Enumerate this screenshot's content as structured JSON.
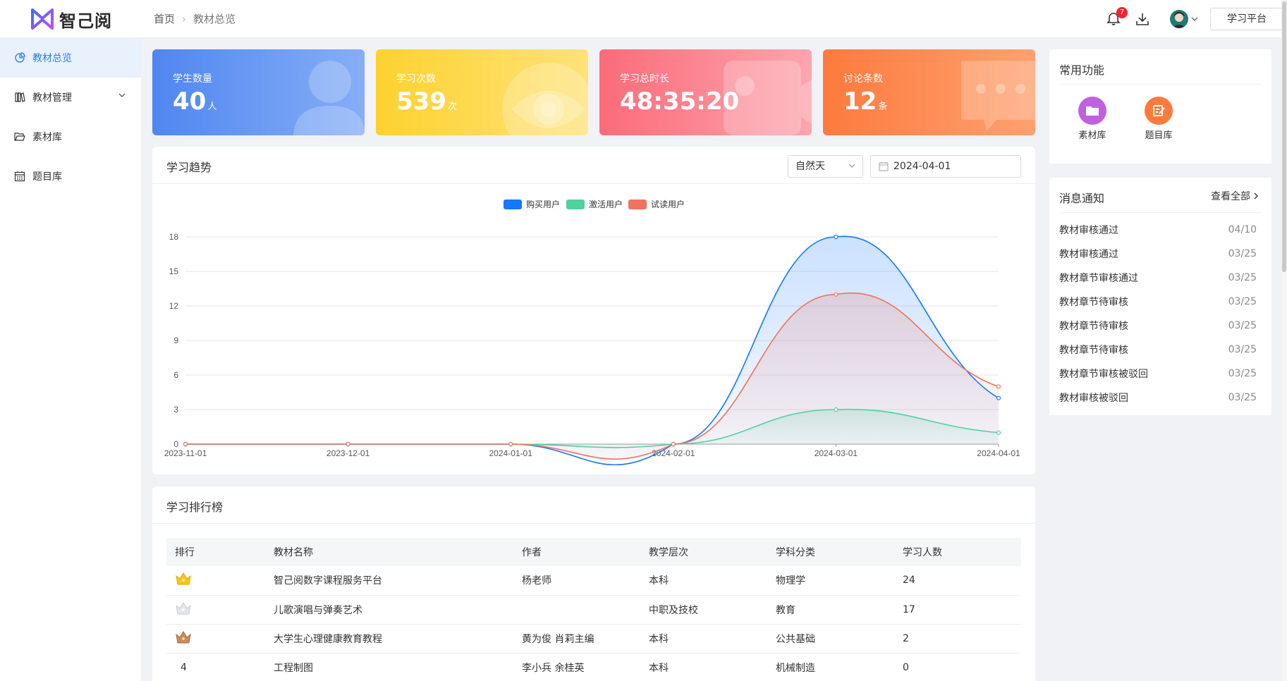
{
  "header": {
    "logo_text": "智己阅",
    "breadcrumb": [
      "首页",
      "教材总览"
    ],
    "notification_count": "7",
    "platform_button": "学习平台"
  },
  "sidebar": {
    "items": [
      {
        "label": "教材总览",
        "icon": "pie-chart-icon",
        "active": true
      },
      {
        "label": "教材管理",
        "icon": "book-icon",
        "has_submenu": true
      },
      {
        "label": "素材库",
        "icon": "folder-icon"
      },
      {
        "label": "题目库",
        "icon": "calendar-grid-icon"
      }
    ]
  },
  "stats": [
    {
      "label": "学生数量",
      "value": "40",
      "unit": "人",
      "color": "#5b8def"
    },
    {
      "label": "学习次数",
      "value": "539",
      "unit": "次",
      "color": "#fdd23c"
    },
    {
      "label": "学习总时长",
      "value": "48:35:20",
      "unit": "",
      "color": "#fb6f7e"
    },
    {
      "label": "讨论条数",
      "value": "12",
      "unit": "条",
      "color": "#fd8a4e"
    }
  ],
  "trend": {
    "title": "学习趋势",
    "select_value": "自然天",
    "date_value": "2024-04-01"
  },
  "chart_data": {
    "type": "line",
    "x": [
      "2023-11-01",
      "2023-12-01",
      "2024-01-01",
      "2024-02-01",
      "2024-03-01",
      "2024-04-01"
    ],
    "ylim": [
      0,
      18
    ],
    "yticks": [
      0,
      3,
      6,
      9,
      12,
      15,
      18
    ],
    "legend_position": "top-center",
    "grid": true,
    "series": [
      {
        "name": "购买用户",
        "values": [
          0,
          0,
          0,
          0,
          18,
          4
        ],
        "color": "#1677ff"
      },
      {
        "name": "激活用户",
        "values": [
          0,
          0,
          0,
          0,
          3,
          1
        ],
        "color": "#4fd1a0"
      },
      {
        "name": "试读用户",
        "values": [
          0,
          0,
          0,
          0,
          13,
          5
        ],
        "color": "#f0735f"
      }
    ]
  },
  "ranking": {
    "title": "学习排行榜",
    "columns": [
      "排行",
      "教材名称",
      "作者",
      "教学层次",
      "学科分类",
      "学习人数"
    ],
    "rows": [
      {
        "rank": "",
        "medal": "gold",
        "name": "智己阅数字课程服务平台",
        "author": "杨老师",
        "level": "本科",
        "subject": "物理学",
        "count": "24"
      },
      {
        "rank": "",
        "medal": "silver",
        "name": "儿歌演唱与弹奏艺术",
        "author": "",
        "level": "中职及技校",
        "subject": "教育",
        "count": "17"
      },
      {
        "rank": "",
        "medal": "bronze",
        "name": "大学生心理健康教育教程",
        "author": "黄为俊 肖莉主编",
        "level": "本科",
        "subject": "公共基础",
        "count": "2"
      },
      {
        "rank": "4",
        "medal": "",
        "name": "工程制图",
        "author": "李小兵 余桂英",
        "level": "本科",
        "subject": "机械制造",
        "count": "0"
      }
    ]
  },
  "quick_functions": {
    "title": "常用功能",
    "items": [
      {
        "label": "素材库",
        "icon": "folder-icon",
        "color": "#c061e0"
      },
      {
        "label": "题目库",
        "icon": "edit-doc-icon",
        "color": "#fd7a3f"
      }
    ]
  },
  "messages": {
    "title": "消息通知",
    "view_all": "查看全部",
    "items": [
      {
        "text": "教材审核通过",
        "date": "04/10"
      },
      {
        "text": "教材审核通过",
        "date": "03/25"
      },
      {
        "text": "教材章节审核通过",
        "date": "03/25"
      },
      {
        "text": "教材章节待审核",
        "date": "03/25"
      },
      {
        "text": "教材章节待审核",
        "date": "03/25"
      },
      {
        "text": "教材章节待审核",
        "date": "03/25"
      },
      {
        "text": "教材章节审核被驳回",
        "date": "03/25"
      },
      {
        "text": "教材审核被驳回",
        "date": "03/25"
      }
    ]
  }
}
